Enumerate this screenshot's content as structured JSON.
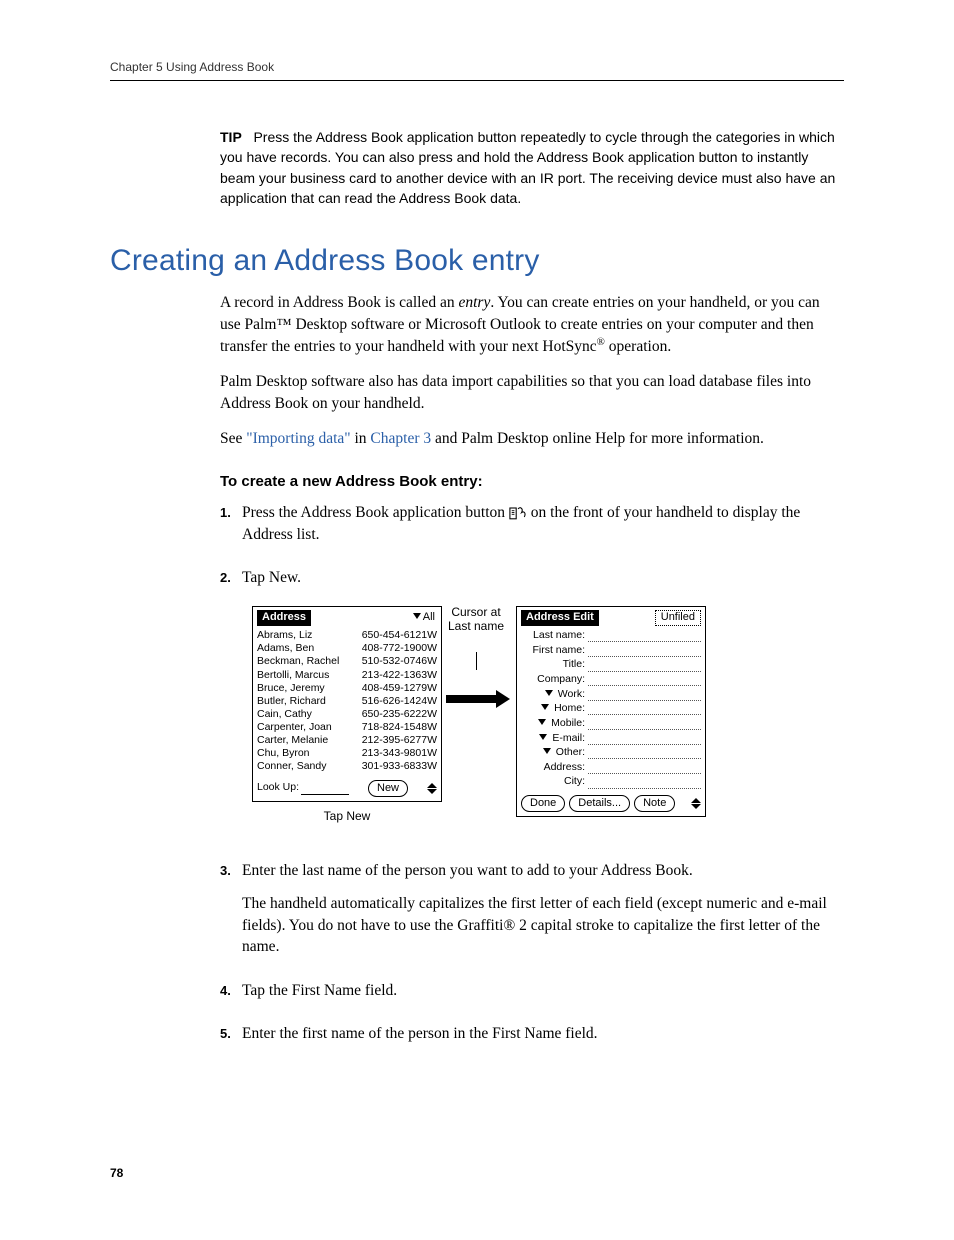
{
  "header": {
    "running": "Chapter 5   Using Address Book"
  },
  "tip": {
    "label": "TIP",
    "text": "Press the Address Book application button repeatedly to cycle through the categories in which you have records. You can also press and hold the Address Book application button to instantly beam your business card to another device with an IR port. The receiving device must also have an application that can read the Address Book data."
  },
  "section_title": "Creating an Address Book entry",
  "para1_a": "A record in Address Book is called an ",
  "para1_em": "entry",
  "para1_b": ". You can create entries on your handheld, or you can use Palm™ Desktop software or Microsoft Outlook to create entries on your computer and then transfer the entries to your handheld with your next HotSync",
  "para1_c": " operation.",
  "para2": "Palm Desktop software also has data import capabilities so that you can load database files into Address Book on your handheld.",
  "para3_a": "See ",
  "para3_link1": "\"Importing data\"",
  "para3_b": " in ",
  "para3_link2": "Chapter 3",
  "para3_c": " and Palm Desktop online Help for more information.",
  "subhead": "To create a new Address Book entry:",
  "step1_a": "Press the Address Book application button ",
  "step1_b": " on the front of your handheld to display the Address list.",
  "step2": "Tap New.",
  "step3": "Enter the last name of the person you want to add to your Address Book.",
  "step3_para": "The handheld automatically capitalizes the first letter of each field (except numeric and e-mail fields). You do not have to use the Graffiti® 2 capital stroke to capitalize the first letter of the name.",
  "step4": "Tap the First Name field.",
  "step5": "Enter the first name of the person in the First Name field.",
  "figure": {
    "cursor_label": "Cursor at Last name",
    "tap_new": "Tap New",
    "left": {
      "title": "Address",
      "category": "All",
      "rows": [
        {
          "name": "Abrams, Liz",
          "phone": "650-454-6121W"
        },
        {
          "name": "Adams, Ben",
          "phone": "408-772-1900W"
        },
        {
          "name": "Beckman, Rachel",
          "phone": "510-532-0746W"
        },
        {
          "name": "Bertolli, Marcus",
          "phone": "213-422-1363W"
        },
        {
          "name": "Bruce, Jeremy",
          "phone": "408-459-1279W"
        },
        {
          "name": "Butler, Richard",
          "phone": "516-626-1424W"
        },
        {
          "name": "Cain, Cathy",
          "phone": "650-235-6222W"
        },
        {
          "name": "Carpenter, Joan",
          "phone": "718-824-1548W"
        },
        {
          "name": "Carter, Melanie",
          "phone": "212-395-6277W"
        },
        {
          "name": "Chu, Byron",
          "phone": "213-343-9801W"
        },
        {
          "name": "Conner, Sandy",
          "phone": "301-933-6833W"
        }
      ],
      "lookup": "Look Up:",
      "new_btn": "New"
    },
    "right": {
      "title": "Address Edit",
      "category": "Unfiled",
      "fields": [
        {
          "label": "Last name:",
          "drop": false
        },
        {
          "label": "First name:",
          "drop": false
        },
        {
          "label": "Title:",
          "drop": false
        },
        {
          "label": "Company:",
          "drop": false
        },
        {
          "label": "Work:",
          "drop": true
        },
        {
          "label": "Home:",
          "drop": true
        },
        {
          "label": "Mobile:",
          "drop": true
        },
        {
          "label": "E-mail:",
          "drop": true
        },
        {
          "label": "Other:",
          "drop": true
        },
        {
          "label": "Address:",
          "drop": false
        },
        {
          "label": "City:",
          "drop": false
        }
      ],
      "done": "Done",
      "details": "Details...",
      "note": "Note"
    }
  },
  "page_number": "78"
}
